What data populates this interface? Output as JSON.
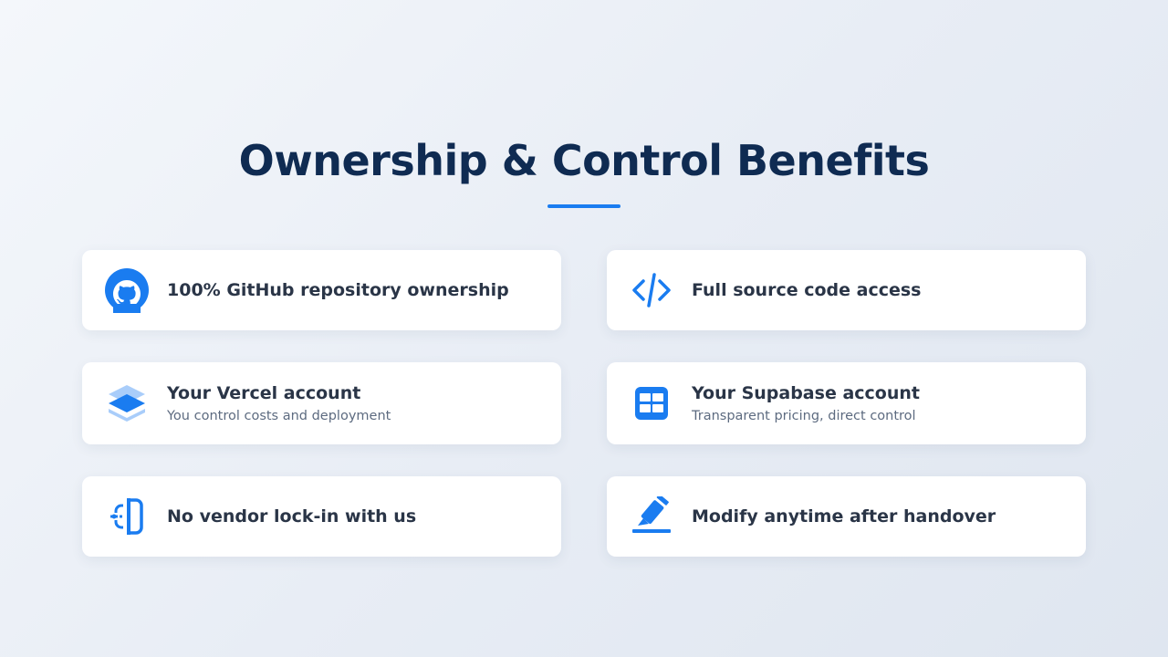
{
  "page": {
    "title": "Ownership & Control Benefits",
    "accent_color": "#1a7cf0",
    "title_color": "#0f2b52"
  },
  "benefits": [
    {
      "icon": "github-icon",
      "label": "100% GitHub repository ownership",
      "sub": ""
    },
    {
      "icon": "code-icon",
      "label": "Full source code access",
      "sub": ""
    },
    {
      "icon": "layers-icon",
      "label": "Your Vercel account",
      "sub": "You control costs and deployment"
    },
    {
      "icon": "table-icon",
      "label": "Your Supabase account",
      "sub": "Transparent pricing, direct control"
    },
    {
      "icon": "unlink-icon",
      "label": "No vendor lock-in with us",
      "sub": ""
    },
    {
      "icon": "edit-icon",
      "label": "Modify anytime after handover",
      "sub": ""
    }
  ]
}
